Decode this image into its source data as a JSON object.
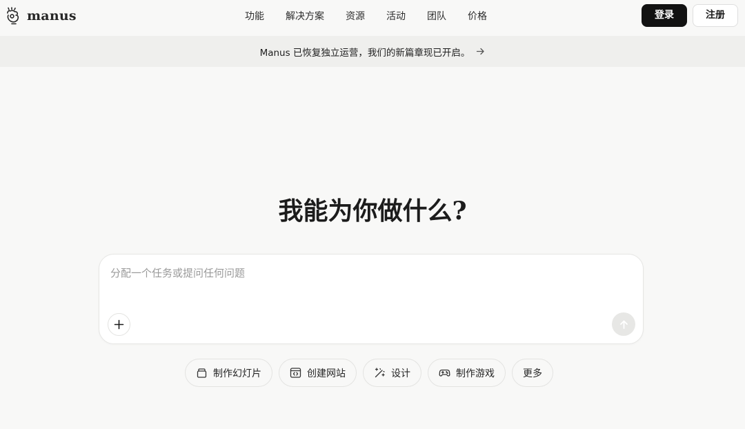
{
  "brand": {
    "name": "manus",
    "logo_icon": "manus-hand-icon"
  },
  "nav": {
    "links": [
      "功能",
      "解决方案",
      "资源",
      "活动",
      "团队",
      "价格"
    ]
  },
  "auth": {
    "login_label": "登录",
    "signup_label": "注册"
  },
  "banner": {
    "text": "Manus 已恢复独立运营，我们的新篇章现已开启。",
    "icon": "arrow-right-icon"
  },
  "hero": {
    "headline": "我能为你做什么?"
  },
  "composer": {
    "placeholder": "分配一个任务或提问任何问题",
    "value": "",
    "attach_icon": "plus-icon",
    "send_icon": "arrow-up-icon"
  },
  "quick_actions": [
    {
      "label": "制作幻灯片",
      "icon": "slides-icon"
    },
    {
      "label": "创建网站",
      "icon": "website-icon"
    },
    {
      "label": "设计",
      "icon": "design-wand-icon"
    },
    {
      "label": "制作游戏",
      "icon": "gamepad-icon"
    },
    {
      "label": "更多",
      "icon": ""
    }
  ],
  "colors": {
    "background": "#f8f8f7",
    "banner_background": "#efefed",
    "primary_button": "#121212",
    "send_button": "#e7e7e5"
  }
}
